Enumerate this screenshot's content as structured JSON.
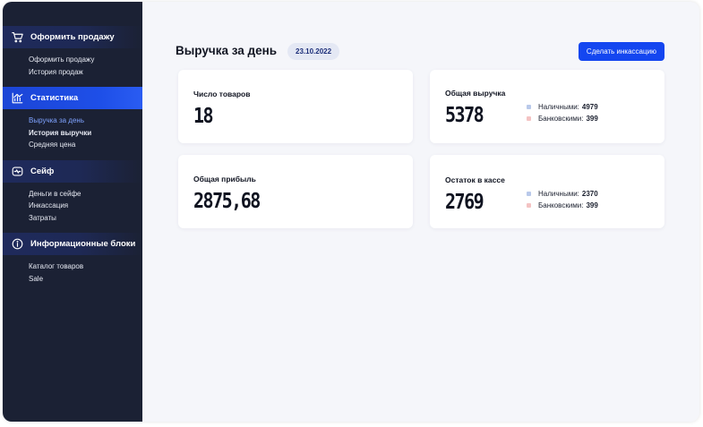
{
  "colors": {
    "sidebar": "#1b2134",
    "accent": "#1446f0",
    "cash": "#b9c9ea",
    "bank": "#f4c3c3"
  },
  "sidebar": {
    "sections": [
      {
        "title": "Оформить продажу",
        "icon": "cart-icon",
        "active": false,
        "items": [
          {
            "label": "Оформить продажу"
          },
          {
            "label": "История продаж"
          }
        ]
      },
      {
        "title": "Статистика",
        "icon": "chart-icon",
        "active": true,
        "items": [
          {
            "label": "Выручка за день",
            "active": true
          },
          {
            "label": "История выручки",
            "bold": true
          },
          {
            "label": "Средняя цена"
          }
        ]
      },
      {
        "title": "Сейф",
        "icon": "safe-icon",
        "active": false,
        "items": [
          {
            "label": "Деньги в сейфе"
          },
          {
            "label": "Инкассация"
          },
          {
            "label": "Затраты"
          }
        ]
      },
      {
        "title": "Информационные блоки",
        "icon": "info-icon",
        "active": false,
        "items": [
          {
            "label": "Каталог товаров"
          },
          {
            "label": "Sale"
          }
        ]
      }
    ]
  },
  "header": {
    "title": "Выручка за день",
    "date": "23.10.2022",
    "collect_button": "Сделать инкассацию"
  },
  "cards": {
    "items_count": {
      "label": "Число товаров",
      "value": "18"
    },
    "total_revenue": {
      "label": "Общая выручка",
      "value": "5378",
      "cash_label": "Наличными:",
      "cash_value": "4979",
      "bank_label": "Банковскими:",
      "bank_value": "399"
    },
    "total_profit": {
      "label": "Общая прибыль",
      "value": "2875,68"
    },
    "cash_balance": {
      "label": "Остаток в кассе",
      "value": "2769",
      "cash_label": "Наличными:",
      "cash_value": "2370",
      "bank_label": "Банковскими:",
      "bank_value": "399"
    }
  }
}
